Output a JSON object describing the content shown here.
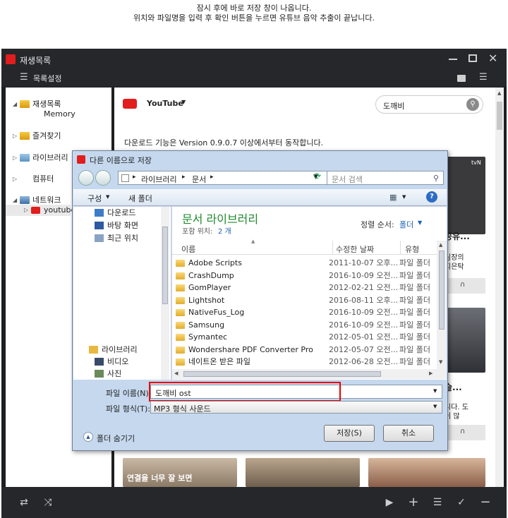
{
  "caption": {
    "line1": "잠시 후에 바로 저장 창이 나옵니다.",
    "line2": "위치와 파일명을 입력 후 확인 버튼을 누르면 유튜브 음악 추출이 끝납니다."
  },
  "app": {
    "title": "재생목록",
    "toolbar_label": "목록설정",
    "tree": {
      "playlist": "재생목록",
      "memory": "Memory",
      "favorites": "즐겨찾기",
      "library": "라이브러리",
      "computer": "컴퓨터",
      "network": "네트워크",
      "youtube": "youtube"
    },
    "content": {
      "source_label": "YouTube",
      "search_value": "도깨비",
      "notice": "다운로드 기능은 Version 0.9.0.7 이상에서부터 동작합니다.",
      "card_snippets": [
        "공유...",
        "심장의",
        "지은탁",
        "슬...",
        "시다. 도",
        "이 많"
      ],
      "banner_text": "연결을 너무 잘 보면",
      "tvn_label": "tvN"
    }
  },
  "dialog": {
    "title": "다른 이름으로 저장",
    "breadcrumb": [
      "라이브러리",
      "문서"
    ],
    "search_placeholder": "문서 검색",
    "organize": "구성",
    "new_folder": "새 폴더",
    "nav": {
      "downloads": "다운로드",
      "desktop": "바탕 화면",
      "recent": "최근 위치",
      "libraries": "라이브러리",
      "videos": "비디오",
      "pictures": "사진"
    },
    "library_title": "문서 라이브러리",
    "includes_label": "포함 위치:",
    "includes_count": "2 개",
    "sort_label": "정렬 순서:",
    "sort_value": "폴더",
    "columns": {
      "name": "이름",
      "modified": "수정한 날짜",
      "type": "유형"
    },
    "files": [
      {
        "name": "Adobe Scripts",
        "date": "2011-10-07 오후...",
        "type": "파일 폴더"
      },
      {
        "name": "CrashDump",
        "date": "2016-10-09 오전...",
        "type": "파일 폴더"
      },
      {
        "name": "GomPlayer",
        "date": "2012-02-21 오전...",
        "type": "파일 폴더"
      },
      {
        "name": "Lightshot",
        "date": "2016-08-11 오후...",
        "type": "파일 폴더"
      },
      {
        "name": "NativeFus_Log",
        "date": "2016-10-09 오전...",
        "type": "파일 폴더"
      },
      {
        "name": "Samsung",
        "date": "2016-10-09 오전...",
        "type": "파일 폴더"
      },
      {
        "name": "Symantec",
        "date": "2012-05-01 오전...",
        "type": "파일 폴더"
      },
      {
        "name": "Wondershare PDF Converter Pro",
        "date": "2012-05-07 오전...",
        "type": "파일 폴더"
      },
      {
        "name": "네이트온 받은 파일",
        "date": "2012-06-28 오전...",
        "type": "파일 폴더"
      }
    ],
    "filename_label": "파일 이름(N):",
    "filename_value": "도깨비 ost",
    "filetype_label": "파일 형식(T):",
    "filetype_value": "MP3 형식 사운드",
    "hide_folders": "폴더 숨기기",
    "save_button": "저장(S)",
    "cancel_button": "취소"
  },
  "colors": {
    "app_bg": "#1e1f23",
    "accent_red": "#e21d1d",
    "library_title": "#1e8a2e",
    "link_blue": "#1a5fb4",
    "highlight_box": "#e60000"
  }
}
